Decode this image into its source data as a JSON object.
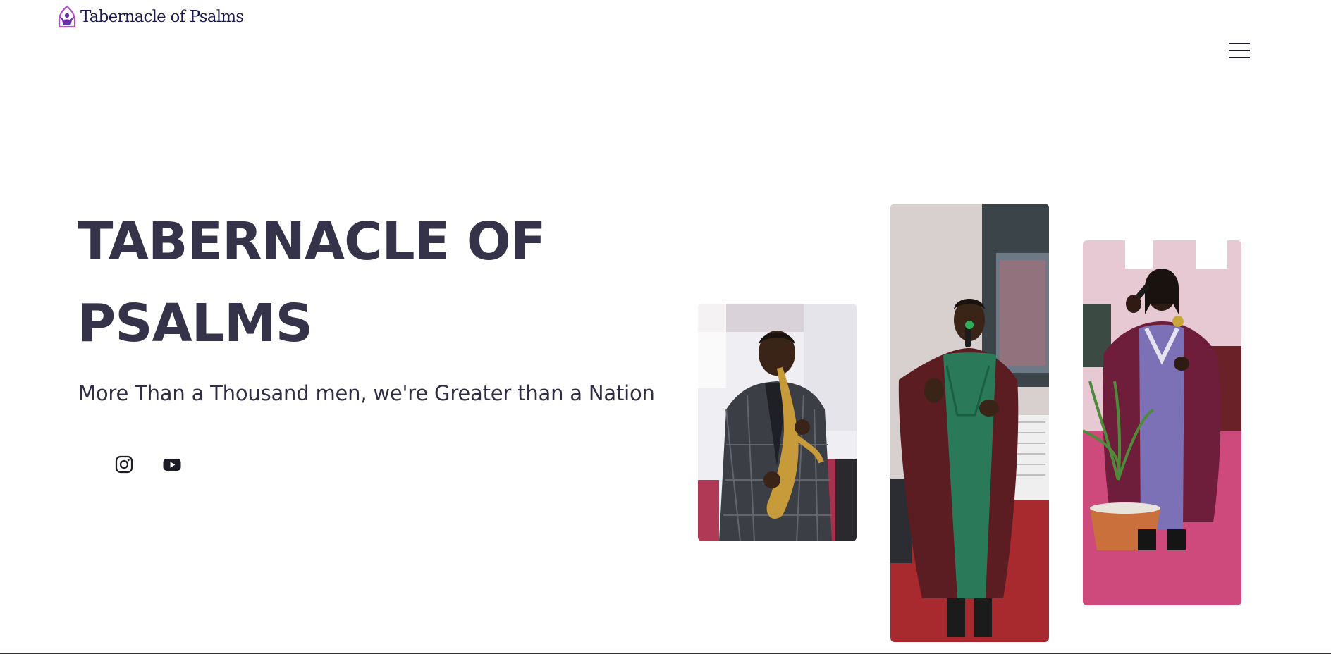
{
  "header": {
    "logo_text": "Tabernacle of Psalms",
    "logo_icon": "hooded-figure-logo-icon",
    "menu_icon": "hamburger-menu-icon"
  },
  "hero": {
    "title_line1": "TABERNACLE OF",
    "title_line2": "PSALMS",
    "tagline": "More Than a Thousand men, we're Greater than a Nation"
  },
  "social": [
    {
      "name": "Instagram",
      "icon": "instagram-icon"
    },
    {
      "name": "YouTube",
      "icon": "youtube-icon"
    }
  ],
  "gallery": [
    {
      "subject": "saxophonist",
      "icon": "photo"
    },
    {
      "subject": "singer-green-robe",
      "icon": "photo"
    },
    {
      "subject": "singer-purple-robe",
      "icon": "photo"
    }
  ],
  "colors": {
    "brand_dark": "#1b1a4e",
    "logo_accent": "#b34fd1",
    "heading": "#34334a"
  }
}
